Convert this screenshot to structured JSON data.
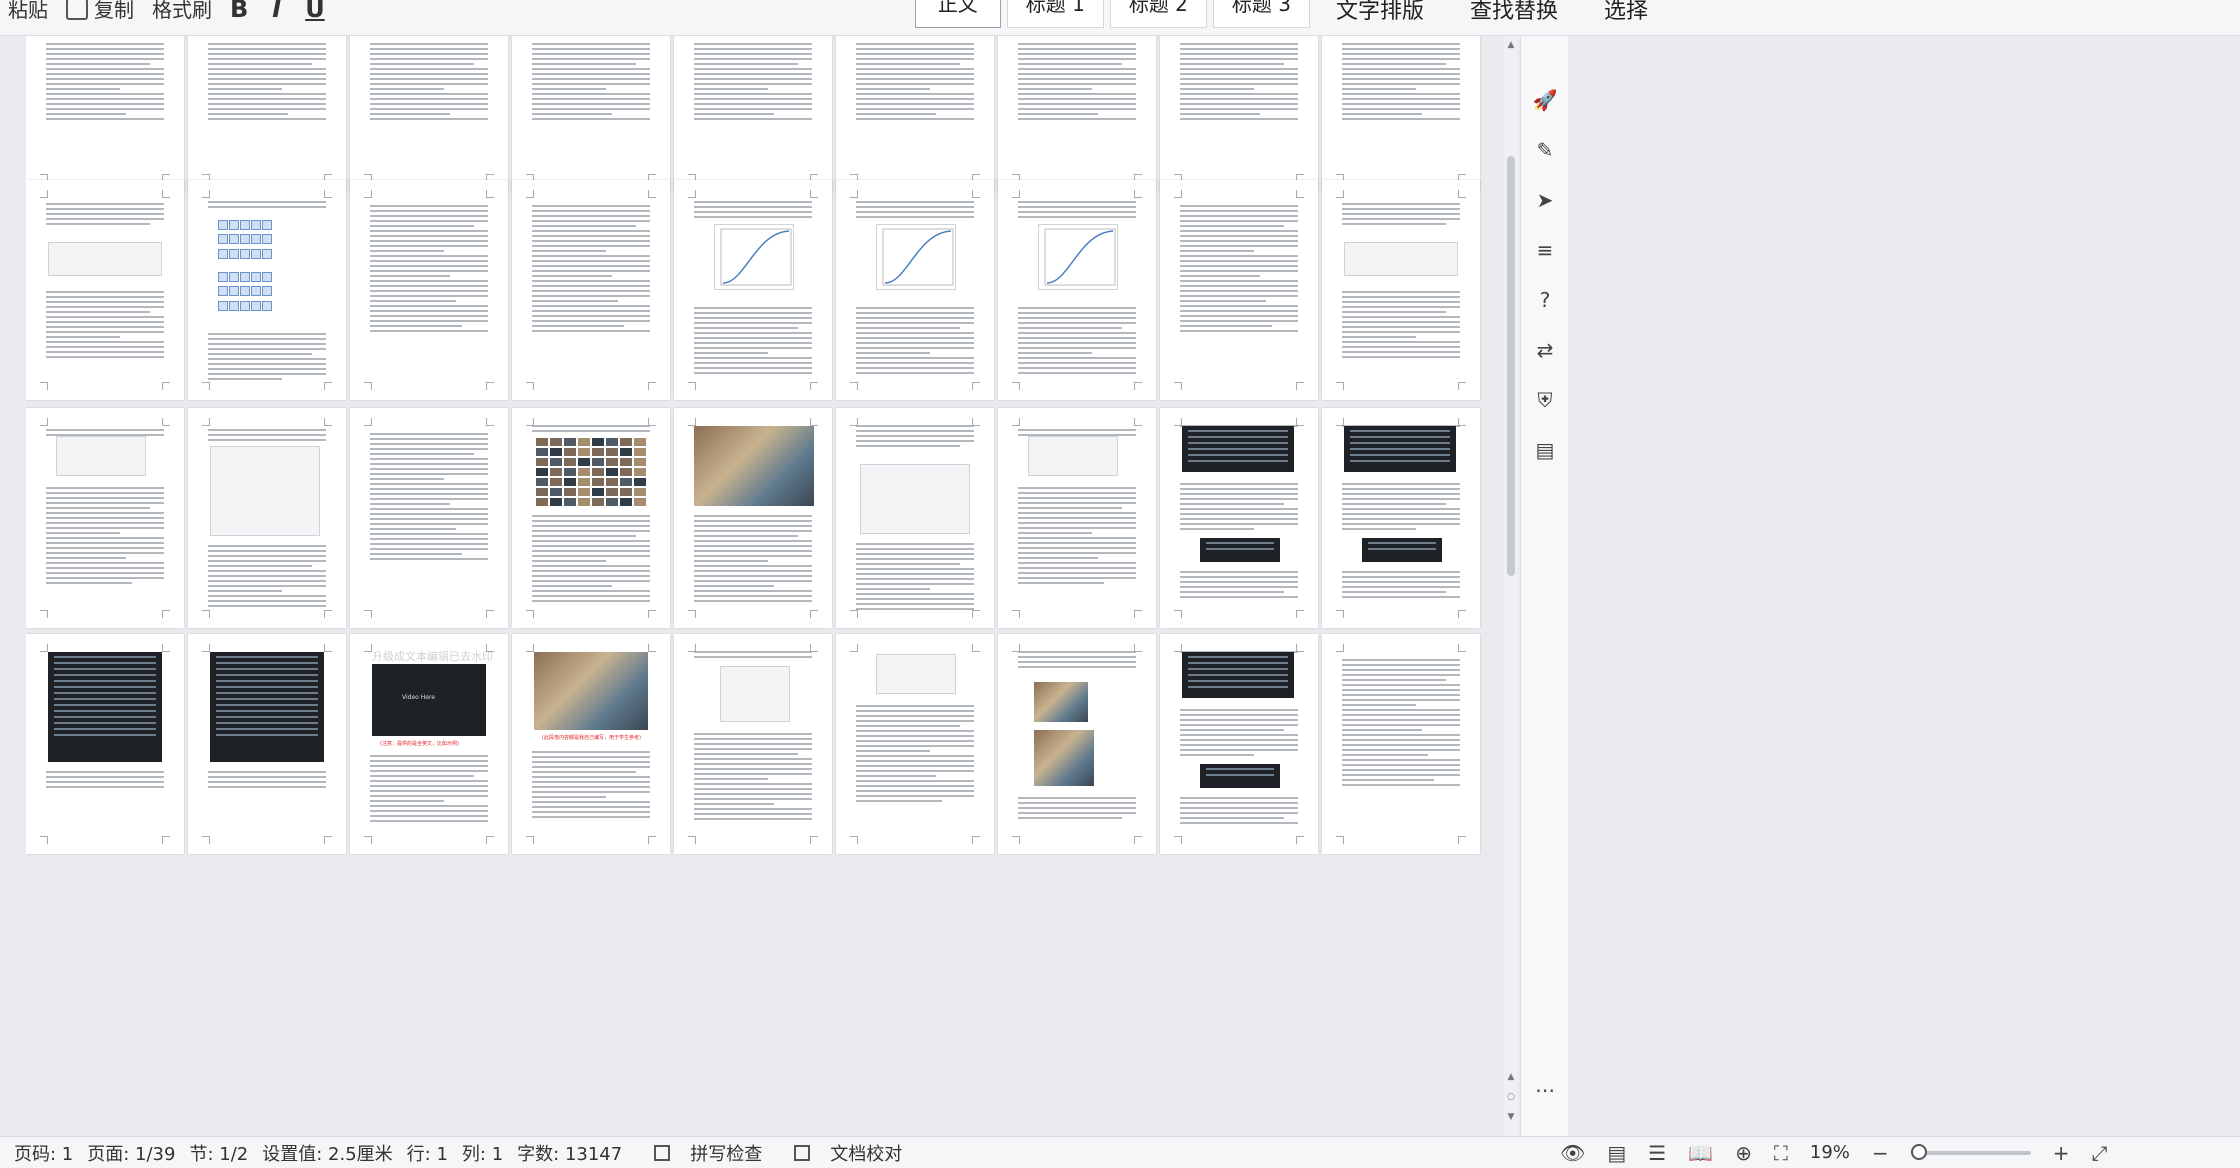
{
  "ribbon": {
    "new_label": "粘贴",
    "copy_label": "复制",
    "format_painter_label": "格式刷",
    "bold": "B",
    "italic": "I",
    "underline": "U",
    "styles": [
      "正文",
      "标题 1",
      "标题 2",
      "标题 3"
    ],
    "text_layout_label": "文字排版",
    "find_replace_label": "查找替换",
    "select_label": "选择"
  },
  "document": {
    "red_note_1": "(此段落内容都是我自己编写，用于学生参考)",
    "red_note_2": "(注意：提供的是全英文，比如示例)",
    "watermark": "升级成文本编辑已去水印",
    "video_label": "Video Here"
  },
  "statusbar": {
    "page_code": "页码: 1",
    "page": "页面: 1/39",
    "section": "节: 1/2",
    "setting": "设置值: 2.5厘米",
    "row": "行: 1",
    "col": "列: 1",
    "word_count": "字数: 13147",
    "spell_check": "拼写检查",
    "doc_proof": "文档校对",
    "zoom": "19%"
  },
  "sidebar_icons": [
    "rocket-icon",
    "pen-icon",
    "cursor-icon",
    "sliders-icon",
    "help-icon",
    "translate-icon",
    "shield-icon",
    "book-icon"
  ]
}
